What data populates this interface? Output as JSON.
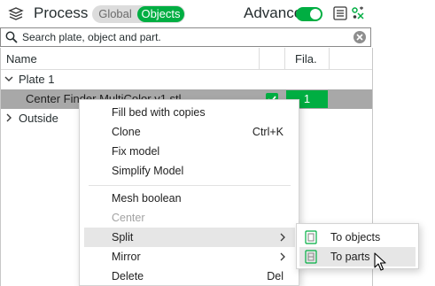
{
  "header": {
    "title": "Process",
    "tab_global": "Global",
    "tab_objects": "Objects",
    "active_tab": "Objects",
    "advance_label": "Advance",
    "advance_on": true,
    "process_icon": "layers-icon",
    "list_icon": "list-icon",
    "tool_icon": "settings-tool-icon"
  },
  "search": {
    "placeholder": "Search plate, object and part.",
    "icon": "search-icon",
    "clear_icon": "clear-icon"
  },
  "table": {
    "col_name": "Name",
    "col_filament": "Fila."
  },
  "tree": {
    "plate_label": "Plate 1",
    "object_label": "Center Finder MultiColor v1.stl",
    "object_filament": "1",
    "object_checked": true,
    "outside_label": "Outside"
  },
  "menu": {
    "items": [
      {
        "label": "Fill bed with copies",
        "shortcut": ""
      },
      {
        "label": "Clone",
        "shortcut": "Ctrl+K"
      },
      {
        "label": "Fix model",
        "shortcut": ""
      },
      {
        "label": "Simplify Model",
        "shortcut": ""
      },
      {
        "label": "Mesh boolean",
        "shortcut": ""
      },
      {
        "label": "Center",
        "shortcut": "",
        "disabled": true
      },
      {
        "label": "Split",
        "shortcut": "",
        "submenu": true
      },
      {
        "label": "Mirror",
        "shortcut": "",
        "submenu": true
      },
      {
        "label": "Delete",
        "shortcut": "Del"
      }
    ]
  },
  "submenu": {
    "items": [
      {
        "label": "To objects",
        "icon": "split-objects-icon"
      },
      {
        "label": "To parts",
        "icon": "split-parts-icon"
      }
    ]
  },
  "colors": {
    "accent": "#00ae42",
    "selected_row": "#a8a8a8",
    "hover": "#e6e6e6"
  }
}
